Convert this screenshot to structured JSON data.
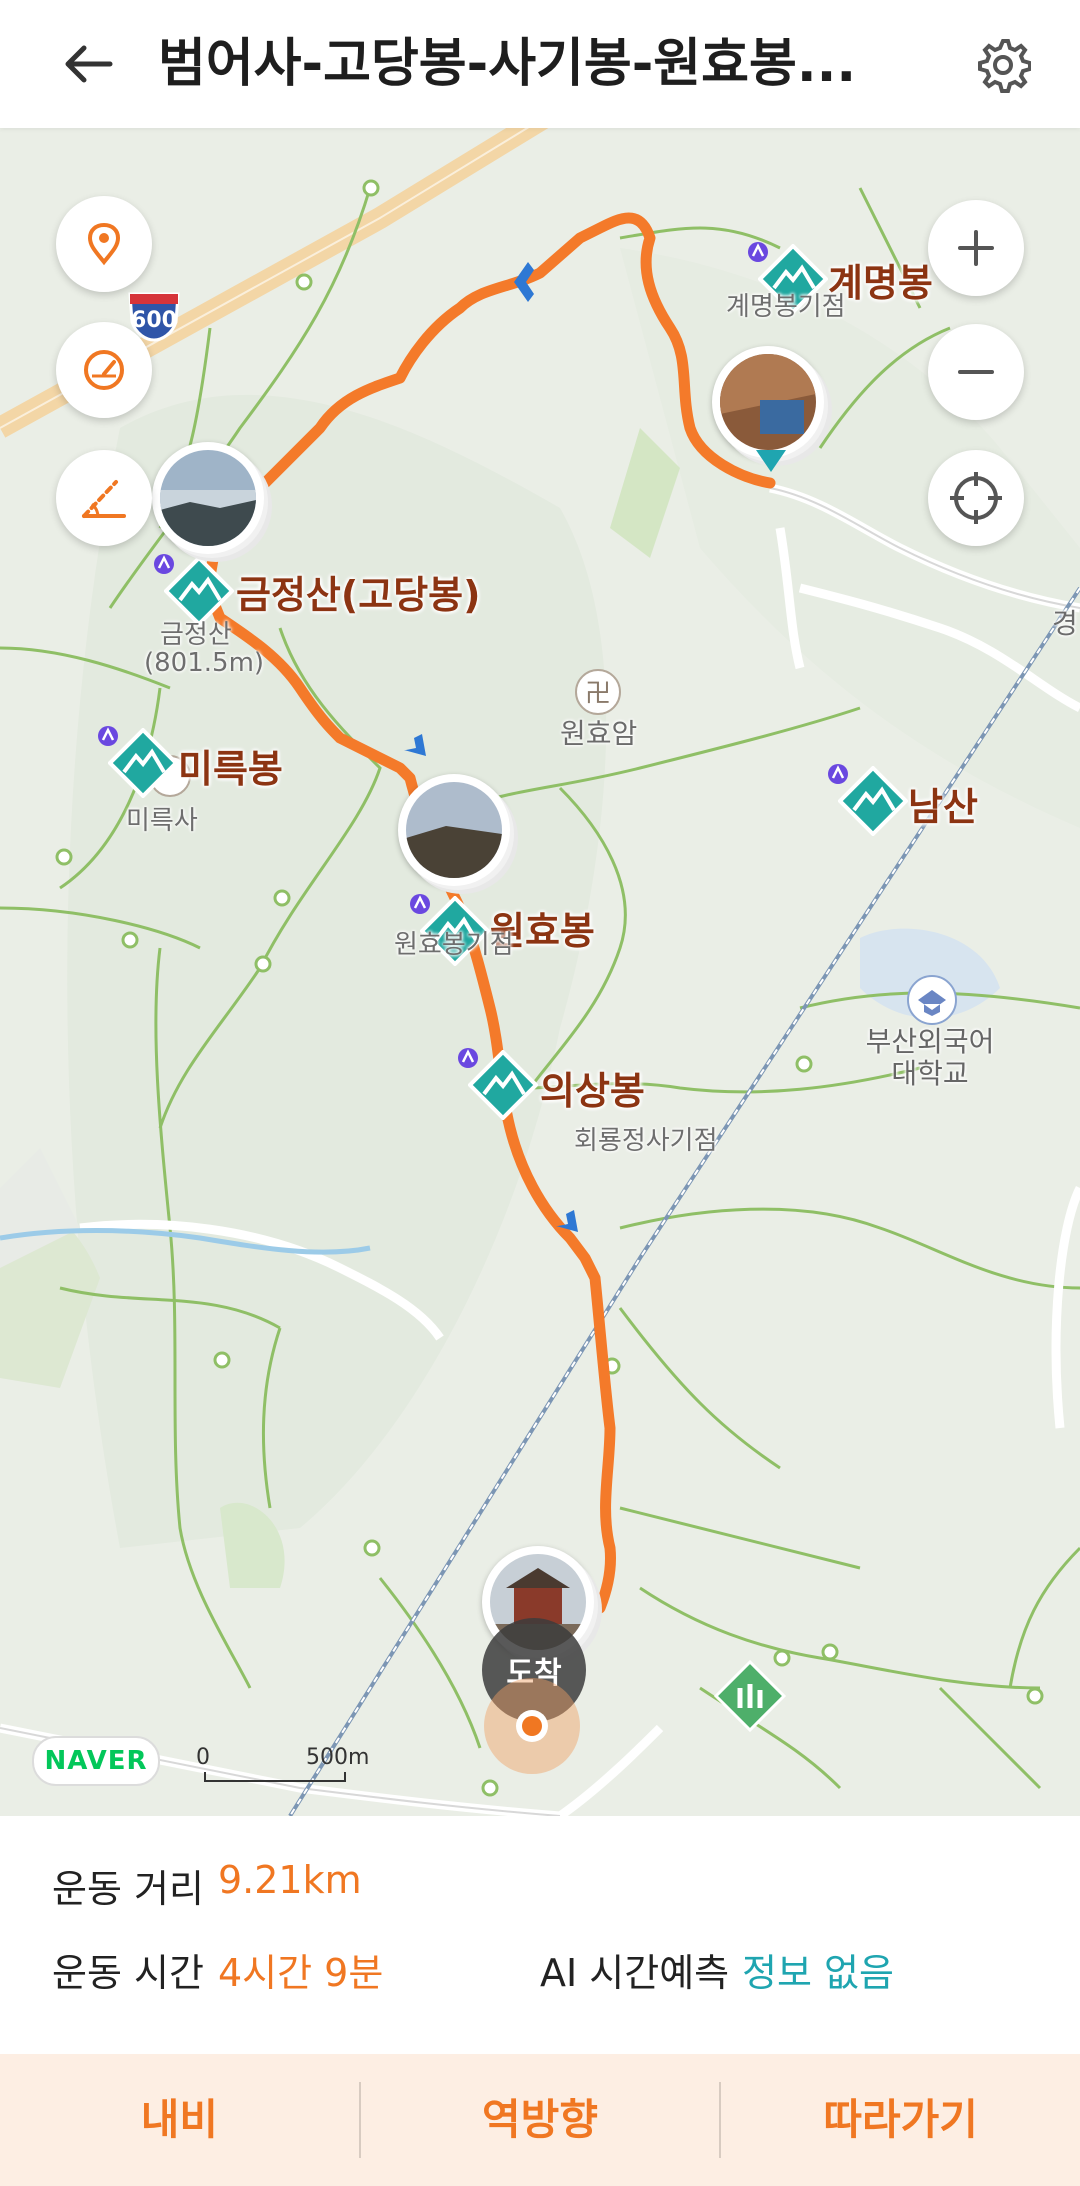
{
  "header": {
    "title": "범어사-고당봉-사기봉-원효봉...",
    "back_icon": "arrow-left-icon",
    "settings_icon": "gear-icon"
  },
  "map": {
    "controls": {
      "location_icon": "map-pin-icon",
      "speed_icon": "speedometer-icon",
      "slope_icon": "slope-icon",
      "zoom_in": "+",
      "zoom_out": "−",
      "gps_icon": "crosshair-icon"
    },
    "highway_shield": "600",
    "peaks": [
      {
        "name": "계명봉",
        "sub": "계명봉기점"
      },
      {
        "name": "금정산(고당봉)",
        "sub": "금정산",
        "sub2": "(801.5m)"
      },
      {
        "name": "미륵봉",
        "sub": "미륵사"
      },
      {
        "name": "원효봉",
        "sub": "원효봉기점"
      },
      {
        "name": "의상봉",
        "sub": "회룡정사기점"
      },
      {
        "name": "남산"
      }
    ],
    "pois": {
      "temple": "원효암",
      "university": "부산외국어\n대학교",
      "edge_label": "경"
    },
    "start_marker": "도착",
    "brand": "NAVER",
    "scale": {
      "zero": "0",
      "distance": "500m"
    }
  },
  "info": {
    "distance_label": "운동 거리",
    "distance_value": "9.21km",
    "time_label": "운동 시간",
    "time_value": "4시간 9분",
    "ai_label": "AI 시간예측",
    "ai_value": "정보 없음"
  },
  "actions": {
    "navi": "내비",
    "reverse": "역방향",
    "follow": "따라가기"
  },
  "colors": {
    "route": "#f47a2a",
    "accent": "#f07722",
    "teal": "#1fa5b0",
    "peak_marker": "#20a8a0",
    "naver_green": "#03c75a"
  }
}
